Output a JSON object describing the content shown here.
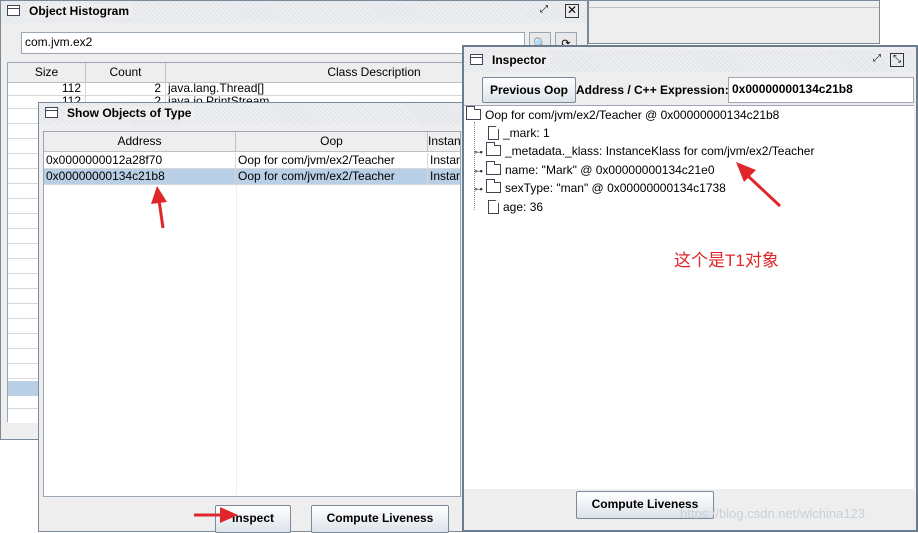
{
  "histogram": {
    "title": "Object Histogram",
    "filter_value": "com.jvm.ex2",
    "columns": [
      "Size",
      "Count",
      "Class Description"
    ],
    "rows": [
      {
        "size": "112",
        "count": "2",
        "desc": "java.lang.Thread[]"
      },
      {
        "size": "112",
        "count": "2",
        "desc": "java.io.PrintStream"
      }
    ]
  },
  "show_objects": {
    "title": "Show Objects of Type",
    "columns": [
      "Address",
      "Oop",
      "Instan"
    ],
    "rows": [
      {
        "address": "0x0000000012a28f70",
        "oop": "Oop for com/jvm/ex2/Teacher",
        "extra": "Instan"
      },
      {
        "address": "0x00000000134c21b8",
        "oop": "Oop for com/jvm/ex2/Teacher",
        "extra": "Instan"
      }
    ],
    "inspect_label": "Inspect",
    "liveness_label": "Compute Liveness"
  },
  "inspector": {
    "title": "Inspector",
    "prev_label": "Previous Oop",
    "address_label": "Address / C++ Expression:",
    "address_value": "0x00000000134c21b8",
    "tree": {
      "root": "Oop for com/jvm/ex2/Teacher @ 0x00000000134c21b8",
      "mark": "_mark: 1",
      "klass": "_metadata._klass: InstanceKlass for com/jvm/ex2/Teacher",
      "name": "name: \"Mark\" @ 0x00000000134c21e0",
      "sextype": "sexType: \"man\" @ 0x00000000134c1738",
      "age": "age: 36"
    },
    "annotation": "这个是T1对象",
    "liveness_label": "Compute Liveness"
  },
  "watermark": "https://blog.csdn.net/wlchina123",
  "colors": {
    "annotation_red": "#e0262a",
    "selection": "#b8cfe5"
  }
}
